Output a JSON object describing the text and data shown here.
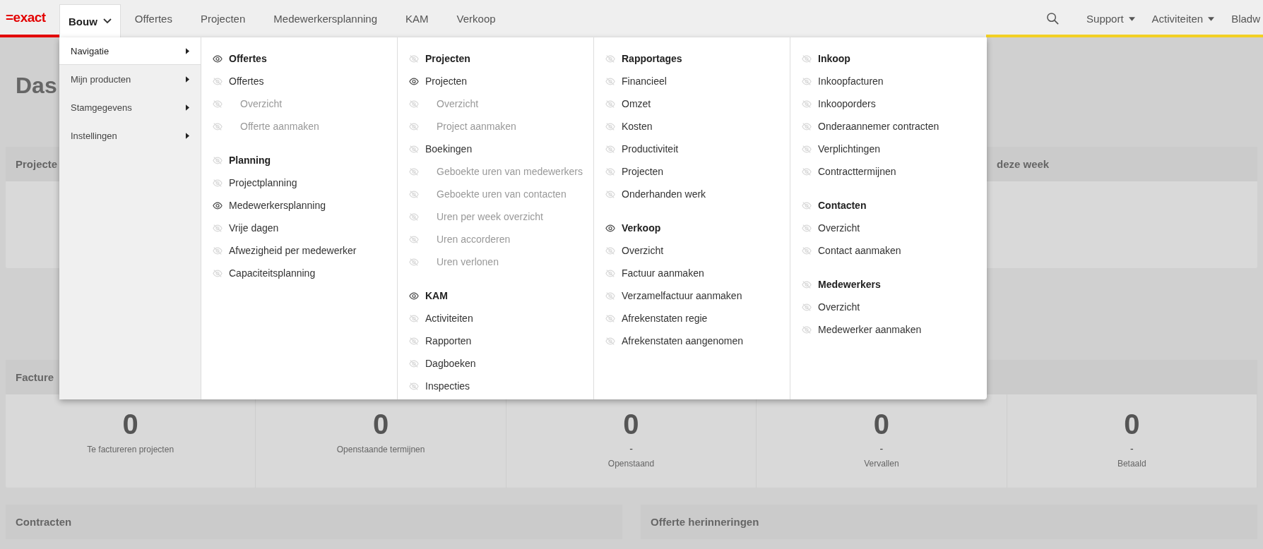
{
  "topbar": {
    "logo": "=exact",
    "tabs": [
      {
        "label": "Bouw",
        "selected": true
      },
      {
        "label": "Offertes",
        "selected": false
      },
      {
        "label": "Projecten",
        "selected": false
      },
      {
        "label": "Medewerkersplanning",
        "selected": false
      },
      {
        "label": "KAM",
        "selected": false
      },
      {
        "label": "Verkoop",
        "selected": false
      }
    ],
    "right_menus": [
      "Support",
      "Activiteiten"
    ],
    "cut_link": "Bladw"
  },
  "mega_menu": {
    "categories": [
      {
        "label": "Navigatie",
        "selected": true
      },
      {
        "label": "Mijn producten",
        "selected": false
      },
      {
        "label": "Stamgegevens",
        "selected": false
      },
      {
        "label": "Instellingen",
        "selected": false
      }
    ],
    "columns": [
      [
        {
          "heading": "Offertes",
          "visible": true,
          "items": [
            {
              "label": "Offertes",
              "visible": false,
              "disabled": false,
              "children": [
                {
                  "label": "Overzicht",
                  "visible": false,
                  "disabled": true
                },
                {
                  "label": "Offerte aanmaken",
                  "visible": false,
                  "disabled": true
                }
              ]
            }
          ]
        },
        {
          "heading": "Planning",
          "visible": false,
          "items": [
            {
              "label": "Projectplanning",
              "visible": false,
              "disabled": false
            },
            {
              "label": "Medewerkersplanning",
              "visible": true,
              "disabled": false
            },
            {
              "label": "Vrije dagen",
              "visible": false,
              "disabled": false
            },
            {
              "label": "Afwezigheid per medewerker",
              "visible": false,
              "disabled": false
            },
            {
              "label": "Capaciteitsplanning",
              "visible": false,
              "disabled": false
            }
          ]
        }
      ],
      [
        {
          "heading": "Projecten",
          "visible": false,
          "items": [
            {
              "label": "Projecten",
              "visible": true,
              "disabled": false,
              "children": [
                {
                  "label": "Overzicht",
                  "visible": false,
                  "disabled": true
                },
                {
                  "label": "Project aanmaken",
                  "visible": false,
                  "disabled": true
                }
              ]
            },
            {
              "label": "Boekingen",
              "visible": false,
              "disabled": false,
              "children": [
                {
                  "label": "Geboekte uren van medewerkers",
                  "visible": false,
                  "disabled": true
                },
                {
                  "label": "Geboekte uren van contacten",
                  "visible": false,
                  "disabled": true
                },
                {
                  "label": "Uren per week overzicht",
                  "visible": false,
                  "disabled": true
                },
                {
                  "label": "Uren accorderen",
                  "visible": false,
                  "disabled": true
                },
                {
                  "label": "Uren verlonen",
                  "visible": false,
                  "disabled": true
                }
              ]
            }
          ]
        },
        {
          "heading": "KAM",
          "visible": true,
          "items": [
            {
              "label": "Activiteiten",
              "visible": false,
              "disabled": false
            },
            {
              "label": "Rapporten",
              "visible": false,
              "disabled": false
            },
            {
              "label": "Dagboeken",
              "visible": false,
              "disabled": false
            },
            {
              "label": "Inspecties",
              "visible": false,
              "disabled": false
            }
          ]
        }
      ],
      [
        {
          "heading": "Rapportages",
          "visible": false,
          "items": [
            {
              "label": "Financieel",
              "visible": false,
              "disabled": false
            },
            {
              "label": "Omzet",
              "visible": false,
              "disabled": false
            },
            {
              "label": "Kosten",
              "visible": false,
              "disabled": false
            },
            {
              "label": "Productiviteit",
              "visible": false,
              "disabled": false
            },
            {
              "label": "Projecten",
              "visible": false,
              "disabled": false
            },
            {
              "label": "Onderhanden werk",
              "visible": false,
              "disabled": false
            }
          ]
        },
        {
          "heading": "Verkoop",
          "visible": true,
          "items": [
            {
              "label": "Overzicht",
              "visible": false,
              "disabled": false
            },
            {
              "label": "Factuur aanmaken",
              "visible": false,
              "disabled": false
            },
            {
              "label": "Verzamelfactuur aanmaken",
              "visible": false,
              "disabled": false
            },
            {
              "label": "Afrekenstaten regie",
              "visible": false,
              "disabled": false
            },
            {
              "label": "Afrekenstaten aangenomen",
              "visible": false,
              "disabled": false
            }
          ]
        }
      ],
      [
        {
          "heading": "Inkoop",
          "visible": false,
          "items": [
            {
              "label": "Inkoopfacturen",
              "visible": false,
              "disabled": false
            },
            {
              "label": "Inkooporders",
              "visible": false,
              "disabled": false
            },
            {
              "label": "Onderaannemer contracten",
              "visible": false,
              "disabled": false
            },
            {
              "label": "Verplichtingen",
              "visible": false,
              "disabled": false
            },
            {
              "label": "Contracttermijnen",
              "visible": false,
              "disabled": false
            }
          ]
        },
        {
          "heading": "Contacten",
          "visible": false,
          "items": [
            {
              "label": "Overzicht",
              "visible": false,
              "disabled": false
            },
            {
              "label": "Contact aanmaken",
              "visible": false,
              "disabled": false
            }
          ]
        },
        {
          "heading": "Medewerkers",
          "visible": false,
          "items": [
            {
              "label": "Overzicht",
              "visible": false,
              "disabled": false
            },
            {
              "label": "Medewerker aanmaken",
              "visible": false,
              "disabled": false
            }
          ]
        }
      ]
    ]
  },
  "dashboard": {
    "title": "Das",
    "panel_left": "Projecte",
    "panel_right": "deze week",
    "invoices": {
      "title": "Facture",
      "stats": [
        {
          "value": "0",
          "label": "Te factureren projecten"
        },
        {
          "value": "0",
          "label": "Openstaande termijnen"
        },
        {
          "value": "0",
          "note": "-",
          "label": "Openstaand"
        },
        {
          "value": "0",
          "note": "-",
          "label": "Vervallen"
        },
        {
          "value": "0",
          "note": "-",
          "label": "Betaald"
        }
      ]
    },
    "bottom_panels": [
      "Contracten",
      "Offerte herinneringen"
    ]
  }
}
